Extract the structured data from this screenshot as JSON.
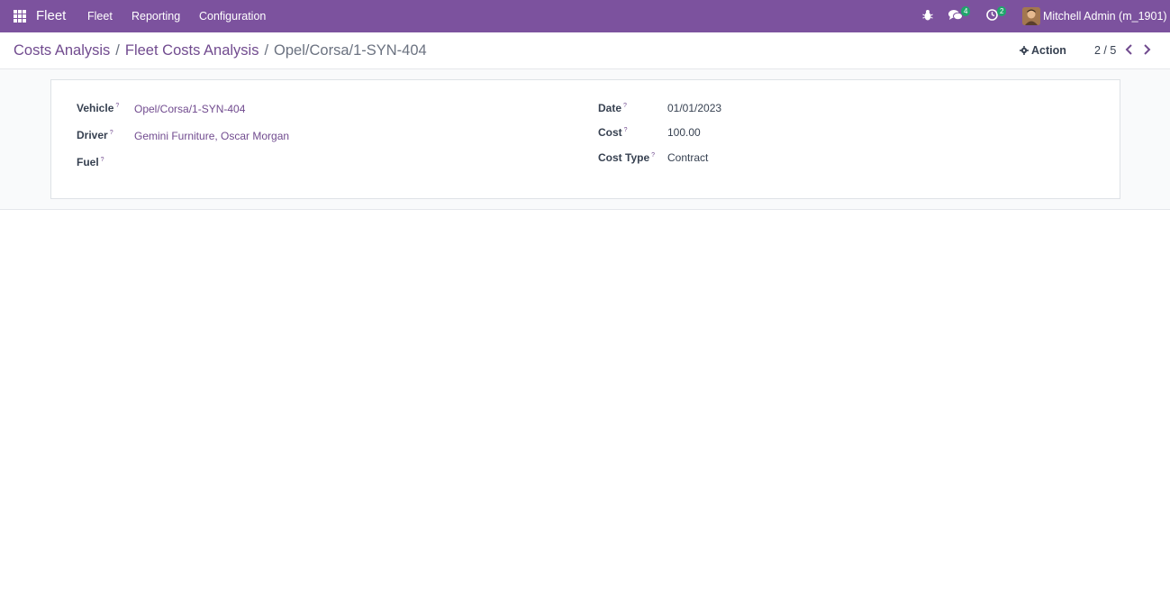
{
  "navbar": {
    "brand": "Fleet",
    "menu": [
      "Fleet",
      "Reporting",
      "Configuration"
    ],
    "messages_count": "4",
    "activities_count": "2",
    "user_name": "Mitchell Admin (m_1901)"
  },
  "breadcrumb": {
    "items": [
      "Costs Analysis",
      "Fleet Costs Analysis"
    ],
    "current": "Opel/Corsa/1-SYN-404"
  },
  "toolbar": {
    "action_label": "Action",
    "pager": "2 / 5"
  },
  "form": {
    "vehicle_label": "Vehicle",
    "vehicle_value": "Opel/Corsa/1-SYN-404",
    "driver_label": "Driver",
    "driver_value": "Gemini Furniture, Oscar Morgan",
    "fuel_label": "Fuel",
    "date_label": "Date",
    "date_value": "01/01/2023",
    "cost_label": "Cost",
    "cost_value": "100.00",
    "cost_type_label": "Cost Type",
    "cost_type_value": "Contract",
    "help_mark": "?"
  },
  "colors": {
    "navbar": "#7c529e",
    "link": "#714b8f",
    "badge": "#20a56c"
  }
}
